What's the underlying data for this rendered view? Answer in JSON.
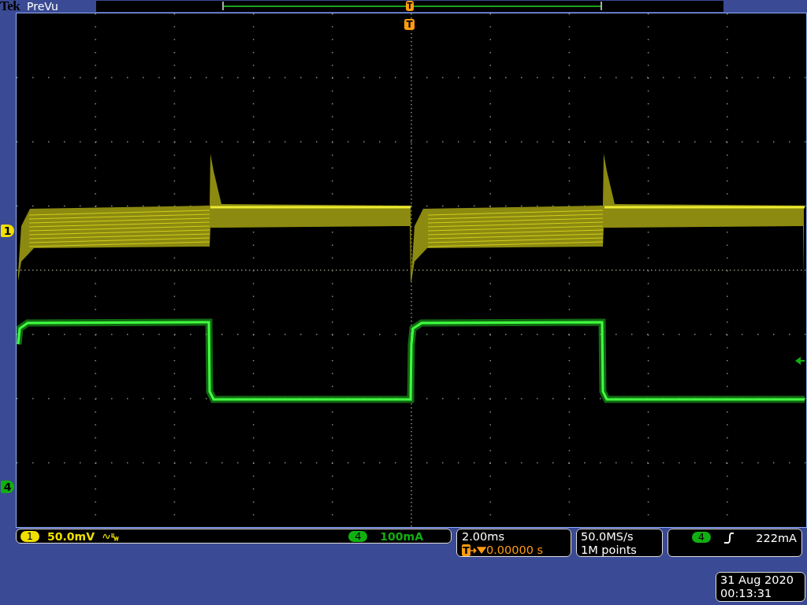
{
  "brand": {
    "logo": "Tek",
    "mode": "PreVu"
  },
  "record_view": {
    "trigger_marker": "T"
  },
  "display": {
    "trigger_position_marker": "T",
    "channel_markers": [
      {
        "label": "1",
        "color": "#f0e000"
      },
      {
        "label": "4",
        "color": "#10b010"
      }
    ]
  },
  "channel_bar": {
    "channels": [
      {
        "label": "1",
        "scale": "50.0mV",
        "bandwidth_limited": true,
        "color": "#f0e000"
      },
      {
        "label": "4",
        "scale": "100mA",
        "bandwidth_limited": false,
        "color": "#10b010"
      }
    ]
  },
  "timebase": {
    "scale": "2.00ms",
    "trigger_marker": "T",
    "position": "0.00000 s"
  },
  "acquisition": {
    "sample_rate": "50.0MS/s",
    "record_length": "1M points"
  },
  "trigger": {
    "source": "4",
    "level": "222mA"
  },
  "datetime": {
    "date": "31 Aug 2020",
    "time": "00:13:31"
  }
}
